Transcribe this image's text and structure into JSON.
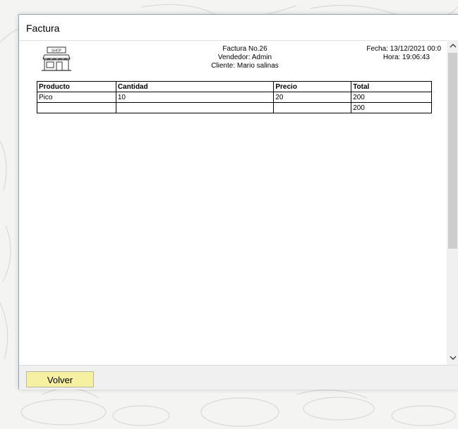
{
  "window": {
    "title": "Factura"
  },
  "report": {
    "factura": "Factura No.26",
    "vendedor": "Vendedor: Admin",
    "cliente": "Cliente: Mario salinas",
    "fecha": "Fecha: 13/12/2021 00:0",
    "hora": "Hora: 19:06:43",
    "logo_text": "SHOP",
    "columns": [
      "Producto",
      "Cantidad",
      "Precio",
      "Total"
    ],
    "rows": [
      [
        "Pico",
        "10",
        "20",
        "200"
      ],
      [
        "",
        "",
        "",
        "200"
      ]
    ]
  },
  "footer": {
    "volver_label": "Volver"
  },
  "colors": {
    "button_bg": "#f6f0a3",
    "window_border": "#9aa6b4"
  },
  "icons": {
    "logo": "shop-storefront-icon",
    "scroll_up": "chevron-up-icon",
    "scroll_down": "chevron-down-icon"
  }
}
